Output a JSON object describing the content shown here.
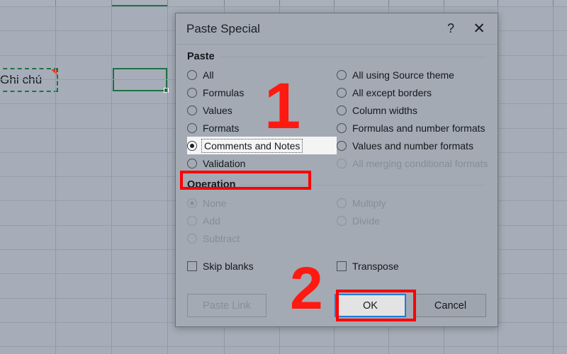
{
  "spreadsheet": {
    "copied_cell_text": "Ghi chú",
    "comment_indicator": "red-comment-triangle"
  },
  "dialog": {
    "title": "Paste Special",
    "help_icon": "?",
    "close_icon": "✕",
    "paste_group": {
      "label": "Paste",
      "left_options": [
        {
          "label": "All",
          "checked": false,
          "disabled": false
        },
        {
          "label": "Formulas",
          "checked": false,
          "disabled": false
        },
        {
          "label": "Values",
          "checked": false,
          "disabled": false
        },
        {
          "label": "Formats",
          "checked": false,
          "disabled": false
        },
        {
          "label": "Comments and Notes",
          "checked": true,
          "disabled": false
        },
        {
          "label": "Validation",
          "checked": false,
          "disabled": false
        }
      ],
      "right_options": [
        {
          "label": "All using Source theme",
          "checked": false,
          "disabled": false
        },
        {
          "label": "All except borders",
          "checked": false,
          "disabled": false
        },
        {
          "label": "Column widths",
          "checked": false,
          "disabled": false
        },
        {
          "label": "Formulas and number formats",
          "checked": false,
          "disabled": false
        },
        {
          "label": "Values and number formats",
          "checked": false,
          "disabled": false
        },
        {
          "label": "All merging conditional formats",
          "checked": false,
          "disabled": true
        }
      ]
    },
    "operation_group": {
      "label": "Operation",
      "left_options": [
        {
          "label": "None",
          "checked": true,
          "disabled": true
        },
        {
          "label": "Add",
          "checked": false,
          "disabled": true
        },
        {
          "label": "Subtract",
          "checked": false,
          "disabled": true
        }
      ],
      "right_options": [
        {
          "label": "Multiply",
          "checked": false,
          "disabled": true
        },
        {
          "label": "Divide",
          "checked": false,
          "disabled": true
        }
      ]
    },
    "checkboxes": {
      "skip_blanks": {
        "label": "Skip blanks",
        "checked": false
      },
      "transpose": {
        "label": "Transpose",
        "checked": false
      }
    },
    "buttons": {
      "paste_link": {
        "label": "Paste Link",
        "disabled": true
      },
      "ok": {
        "label": "OK",
        "disabled": false,
        "focused": true
      },
      "cancel": {
        "label": "Cancel",
        "disabled": false
      }
    }
  },
  "annotations": {
    "step_one": "1",
    "step_two": "2",
    "highlight_color": "#ff0000"
  },
  "colors": {
    "sheet_background": "#a6adb8",
    "dialog_background": "#a3aab4",
    "excel_green": "#1e7145",
    "focus_blue": "#1a7ddb",
    "annotation_red": "#ff0000"
  }
}
